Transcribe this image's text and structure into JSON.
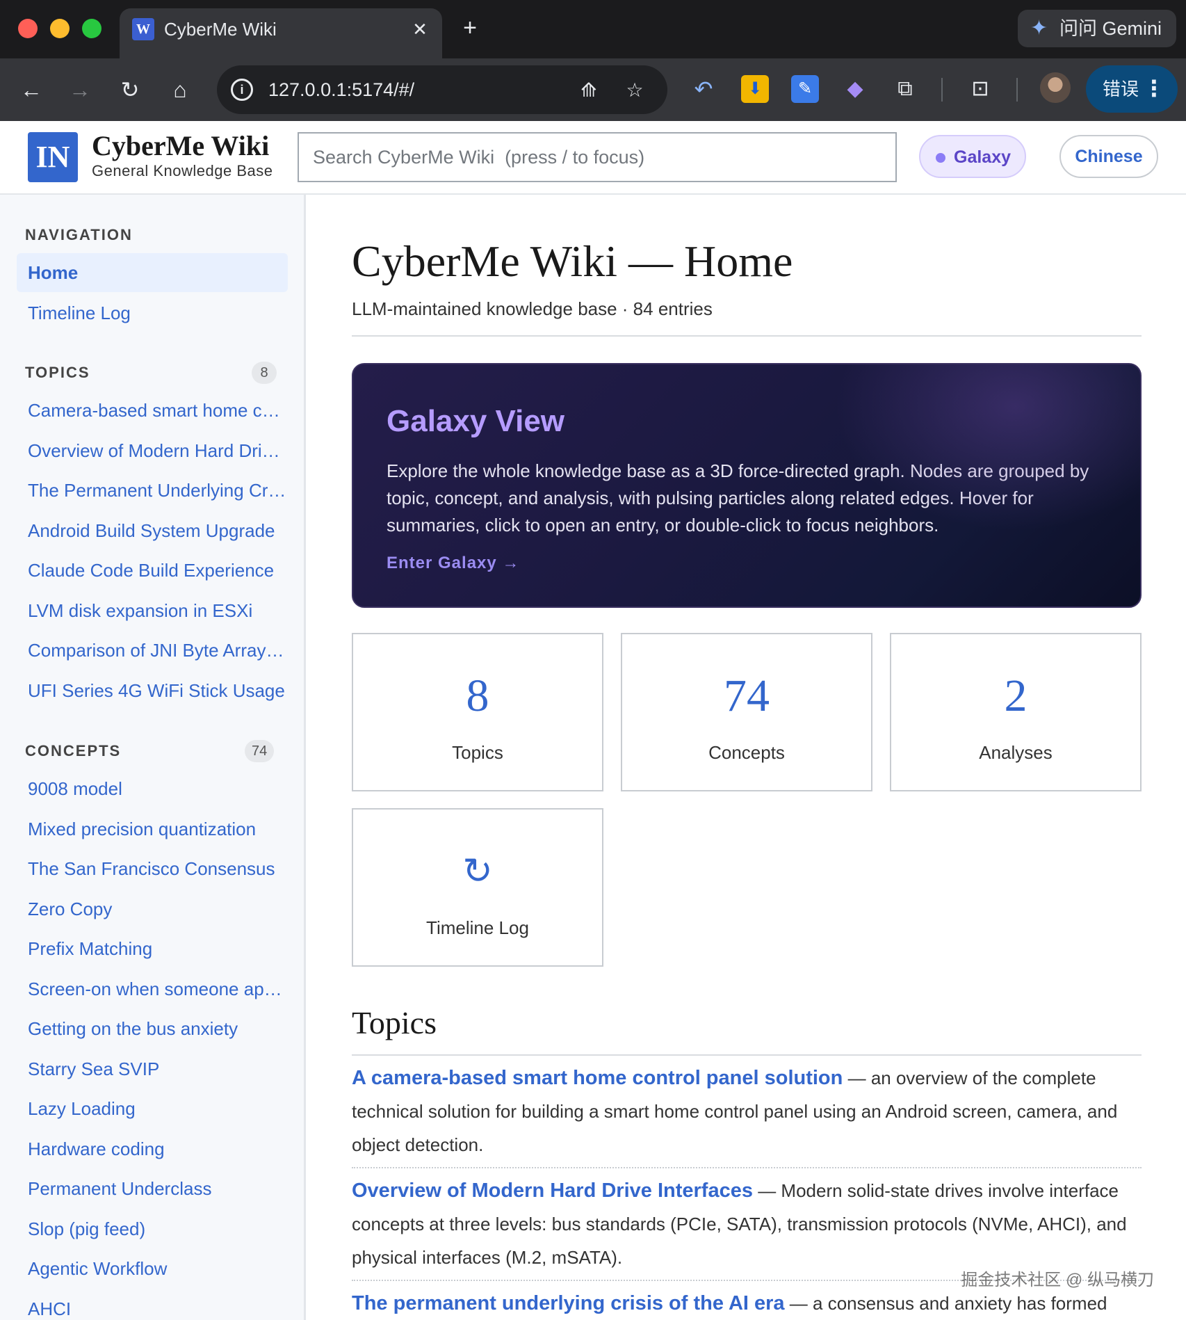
{
  "browser": {
    "tab_title": "CyberMe Wiki",
    "tab_favicon": "W",
    "close_glyph": "✕",
    "new_tab_glyph": "+",
    "gemini_label": "问问 Gemini",
    "url": "127.0.0.1:5174/#/",
    "error_label": "错误",
    "icons": [
      "back-arrow-icon",
      "forward-arrow-icon",
      "reload-icon",
      "home-icon",
      "site-info-icon",
      "translate-icon",
      "bookmark-star-icon",
      "undo-extension-icon",
      "download-extension-icon",
      "screenshot-extension-icon",
      "purple-extension-icon",
      "puzzle-extensions-icon",
      "tab-search-icon",
      "profile-avatar",
      "kebab-menu-icon"
    ]
  },
  "header": {
    "logo": "IN",
    "title": "CyberMe Wiki",
    "tagline": "General Knowledge Base",
    "search_placeholder": "Search CyberMe Wiki  (press / to focus)",
    "galaxy_label": "Galaxy",
    "language_label": "Chinese",
    "accent_color": "#3366cc"
  },
  "sidebar": {
    "navigation_heading": "NAVIGATION",
    "nav": [
      {
        "label": "Home",
        "active": true
      },
      {
        "label": "Timeline Log",
        "active": false
      }
    ],
    "topics_heading": "TOPICS",
    "topics_count": "8",
    "topics": [
      "Camera-based smart home control panel solution",
      "Overview of Modern Hard Drive Interfaces",
      "The Permanent Underlying Crisis of the AI Era",
      "Android Build System Upgrade",
      "Claude Code Build Experience",
      "LVM disk expansion in ESXi",
      "Comparison of JNI Byte Array Passing",
      "UFI Series 4G WiFi Stick Usage"
    ],
    "concepts_heading": "CONCEPTS",
    "concepts_count": "74",
    "concepts": [
      "9008 model",
      "Mixed precision quantization",
      "The San Francisco Consensus",
      "Zero Copy",
      "Prefix Matching",
      "Screen-on when someone approaches",
      "Getting on the bus anxiety",
      "Starry Sea SVIP",
      "Lazy Loading",
      "Hardware coding",
      "Permanent Underclass",
      "Slop (pig feed)",
      "Agentic Workflow",
      "AHCI"
    ]
  },
  "main": {
    "title": "CyberMe Wiki — Home",
    "subtitle": "LLM-maintained knowledge base · 84 entries",
    "galaxy_card": {
      "title": "Galaxy View",
      "description": "Explore the whole knowledge base as a 3D force-directed graph. Nodes are grouped by topic, concept, and analysis, with pulsing particles along related edges. Hover for summaries, click to open an entry, or double-click to focus neighbors.",
      "link": "Enter Galaxy →"
    },
    "stats": [
      {
        "number": "8",
        "label": "Topics"
      },
      {
        "number": "74",
        "label": "Concepts"
      },
      {
        "number": "2",
        "label": "Analyses"
      },
      {
        "number": "↻",
        "label": "Timeline Log"
      }
    ],
    "topics_title": "Topics",
    "topic_entries": [
      {
        "title": "A camera-based smart home control panel solution",
        "summary": " — an overview of the complete technical solution for building a smart home control panel using an Android screen, camera, and object detection."
      },
      {
        "title": "Overview of Modern Hard Drive Interfaces",
        "summary": " — Modern solid-state drives involve interface concepts at three levels: bus standards (PCIe, SATA), transmission protocols (NVMe, AHCI), and physical interfaces (M.2, mSATA)."
      },
      {
        "title": "The permanent underlying crisis of the AI era",
        "summary": " — a consensus and anxiety has formed"
      }
    ]
  },
  "watermark": "掘金技术社区 @ 纵马横刀"
}
